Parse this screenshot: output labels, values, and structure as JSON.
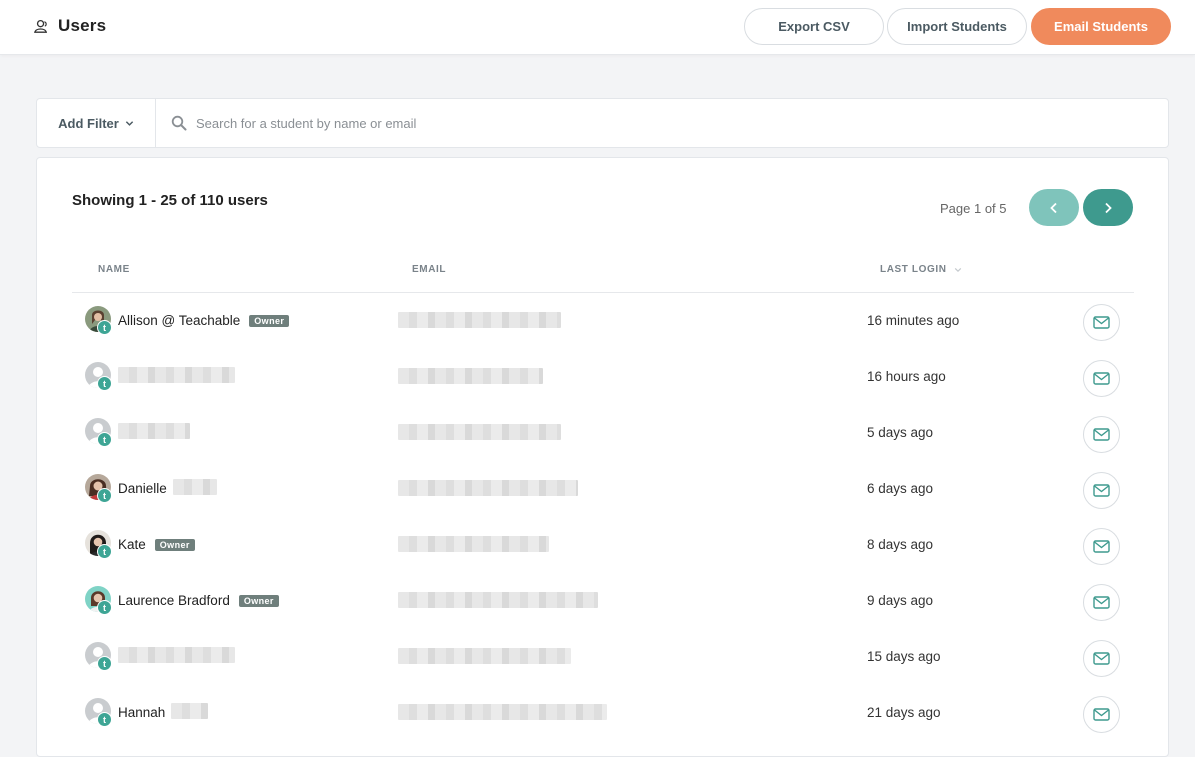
{
  "header": {
    "title": "Users",
    "icon": "users-icon",
    "buttons": {
      "export": "Export CSV",
      "import": "Import Students",
      "email": "Email Students"
    }
  },
  "filter": {
    "add_filter": "Add Filter",
    "search_placeholder": "Search for a student by name or email"
  },
  "list": {
    "showing": "Showing 1 - 25 of 110 users",
    "page_info": "Page 1 of 5",
    "columns": {
      "name": "NAME",
      "email": "EMAIL",
      "last_login": "LAST LOGIN"
    },
    "badge_letter": "t",
    "owner_label": "Owner",
    "rows": [
      {
        "name": "Allison @ Teachable",
        "owner": true,
        "avatar": "photo",
        "last_login": "16 minutes ago"
      },
      {
        "name": "",
        "owner": false,
        "avatar": "default",
        "last_login": "16 hours ago"
      },
      {
        "name": "",
        "owner": false,
        "avatar": "default",
        "last_login": "5 days ago"
      },
      {
        "name": "Danielle",
        "owner": false,
        "avatar": "photo",
        "last_login": "6 days ago"
      },
      {
        "name": "Kate",
        "owner": true,
        "avatar": "photo",
        "last_login": "8 days ago"
      },
      {
        "name": "Laurence Bradford",
        "owner": true,
        "avatar": "photo",
        "last_login": "9 days ago"
      },
      {
        "name": "",
        "owner": false,
        "avatar": "default",
        "last_login": "15 days ago"
      },
      {
        "name": "Hannah",
        "owner": false,
        "avatar": "default",
        "last_login": "21 days ago"
      }
    ]
  },
  "colors": {
    "primary": "#f08a5c",
    "teal": "#3e9a8e",
    "teal_light": "#7fc4bb",
    "owner_badge": "#6f7f7c"
  }
}
